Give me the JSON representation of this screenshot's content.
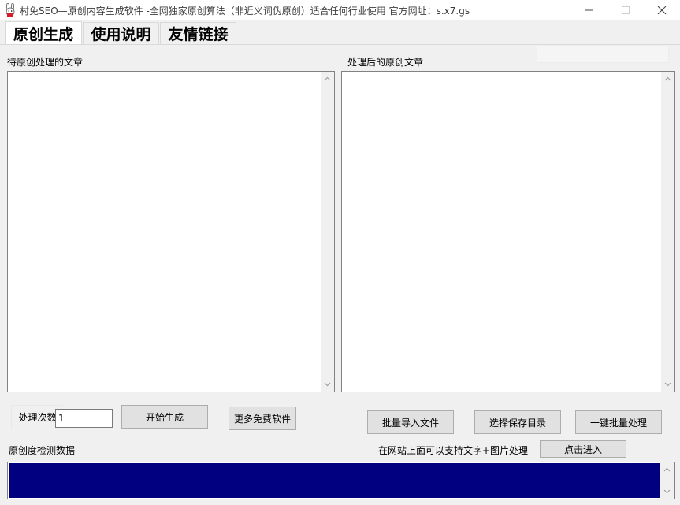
{
  "window": {
    "title": "村免SEO—原创内容生成软件 -全网独家原创算法（非近义词伪原创）适合任何行业使用 官方网址：s.x7.gs",
    "icon": "rabbit-app-icon",
    "controls": [
      "minimize-icon",
      "maximize-icon",
      "close-icon"
    ]
  },
  "tabs": [
    {
      "label": "原创生成",
      "active": true
    },
    {
      "label": "使用说明",
      "active": false
    },
    {
      "label": "友情链接",
      "active": false
    }
  ],
  "source": {
    "label": "待原创处理的文章",
    "value": ""
  },
  "result": {
    "label": "处理后的原创文章",
    "value": ""
  },
  "controls": {
    "count_label": "处理次数",
    "count_value": "1",
    "start_label": "开始生成",
    "more_label": "更多免费软件",
    "batch_import_label": "批量导入文件",
    "choose_dir_label": "选择保存目录",
    "batch_process_label": "一键批量处理"
  },
  "detect": {
    "label": "原创度检测数据"
  },
  "website": {
    "label": "在网站上面可以支持文字+图片处理",
    "enter_label": "点击进入"
  },
  "colors": {
    "detect_panel": "#000080",
    "window_bg": "#f0f0f0"
  }
}
